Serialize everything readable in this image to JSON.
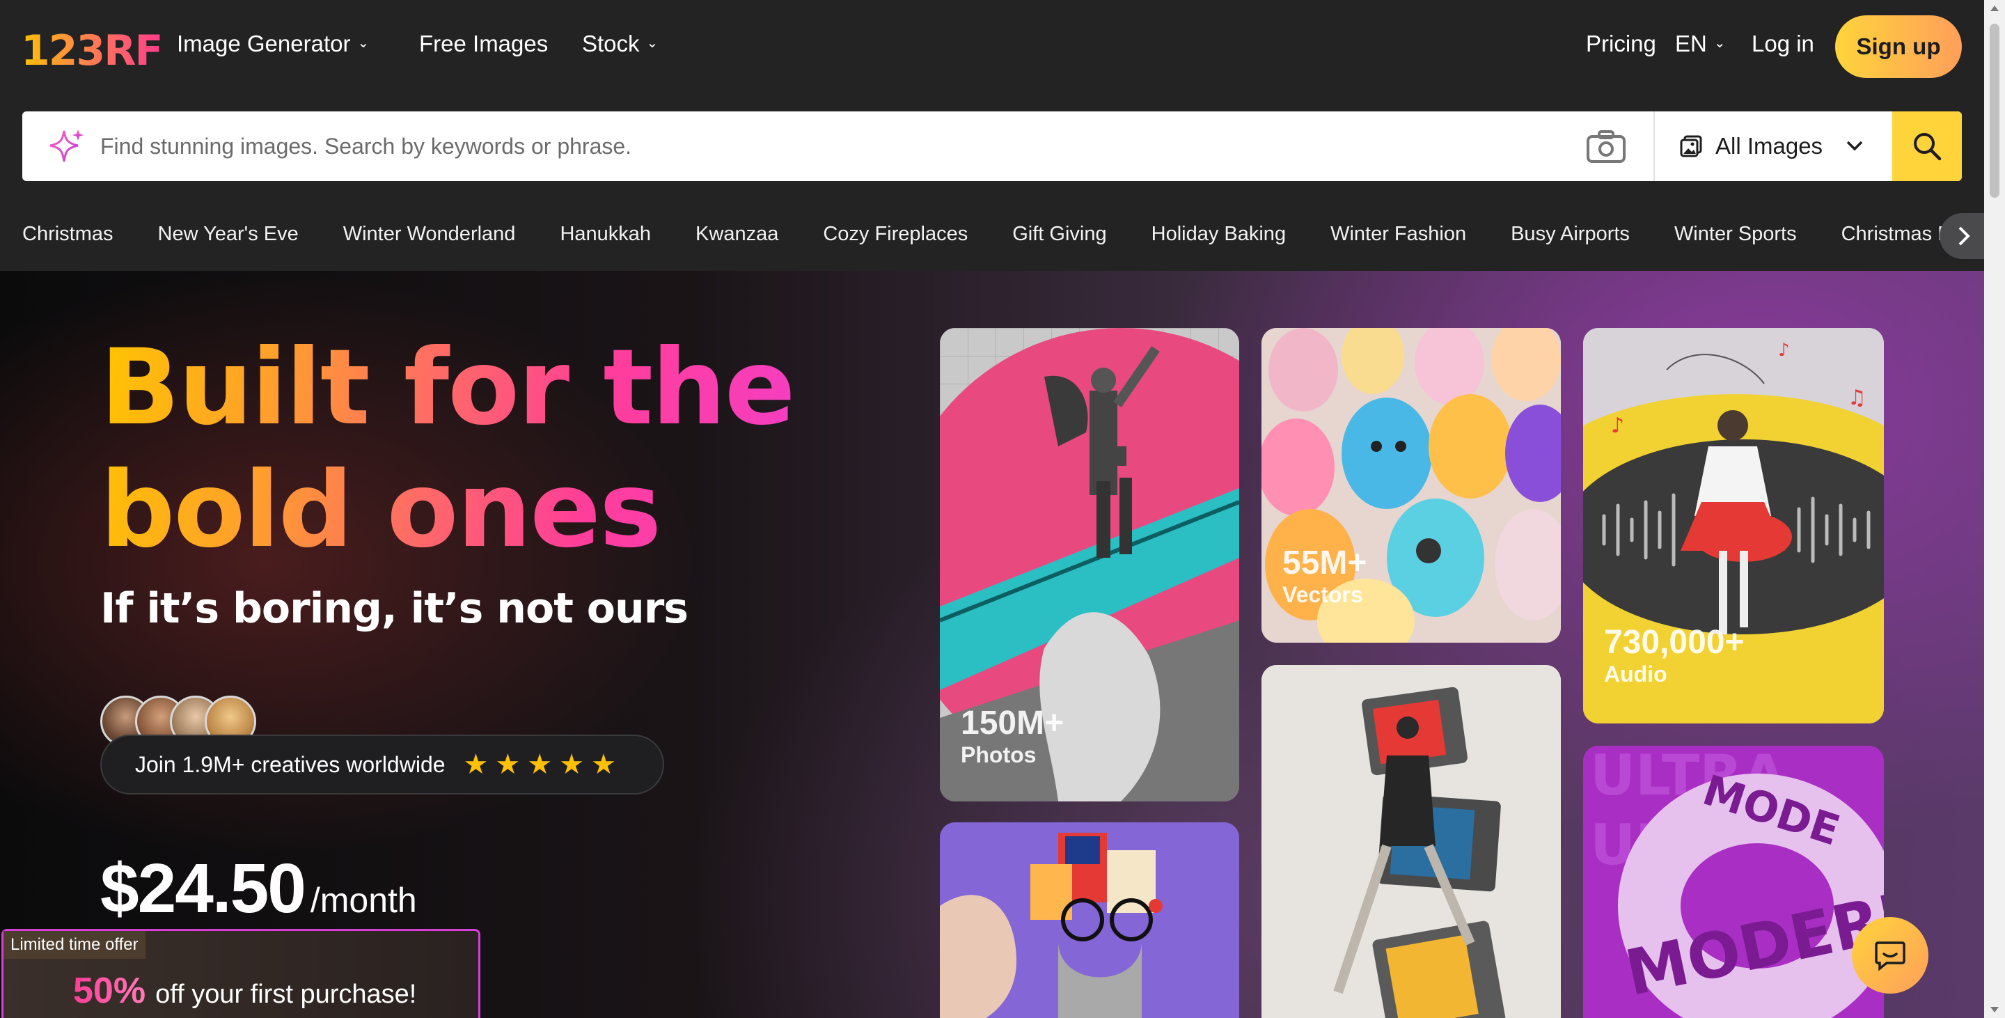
{
  "header": {
    "logo": "123RF",
    "nav": [
      {
        "label": "Image Generator",
        "has_dropdown": true
      },
      {
        "label": "Free Images",
        "has_dropdown": false
      },
      {
        "label": "Stock",
        "has_dropdown": true
      }
    ],
    "pricing": "Pricing",
    "language": "EN",
    "login": "Log in",
    "signup": "Sign up"
  },
  "search": {
    "placeholder": "Find stunning images. Search by keywords or phrase.",
    "type_selected": "All Images",
    "icons": {
      "left": "sparkle-icon",
      "camera": "camera-icon",
      "type": "image-icon",
      "submit": "search-icon"
    }
  },
  "chips": [
    "Christmas",
    "New Year's Eve",
    "Winter Wonderland",
    "Hanukkah",
    "Kwanzaa",
    "Cozy Fireplaces",
    "Gift Giving",
    "Holiday Baking",
    "Winter Fashion",
    "Busy Airports",
    "Winter Sports",
    "Christmas Markets"
  ],
  "hero": {
    "headline_line1": "Built for the",
    "headline_line2": "bold ones",
    "subline": "If it’s boring, it’s not ours",
    "join_text": "Join 1.9M+ creatives worldwide",
    "rating_stars": 5,
    "price": "$24.50",
    "price_period": "/month",
    "promo": {
      "tag": "Limited time offer",
      "percent": "50%",
      "text": "off your first purchase!"
    }
  },
  "tiles": [
    {
      "count": "150M+",
      "kind": "Photos"
    },
    {
      "count": "55M+",
      "kind": "Vectors"
    },
    {
      "count": "730,000+",
      "kind": "Audio"
    }
  ],
  "colors": {
    "accent_yellow": "#ffd43b",
    "accent_pink": "#ff3d9a",
    "header_bg": "#232324"
  }
}
